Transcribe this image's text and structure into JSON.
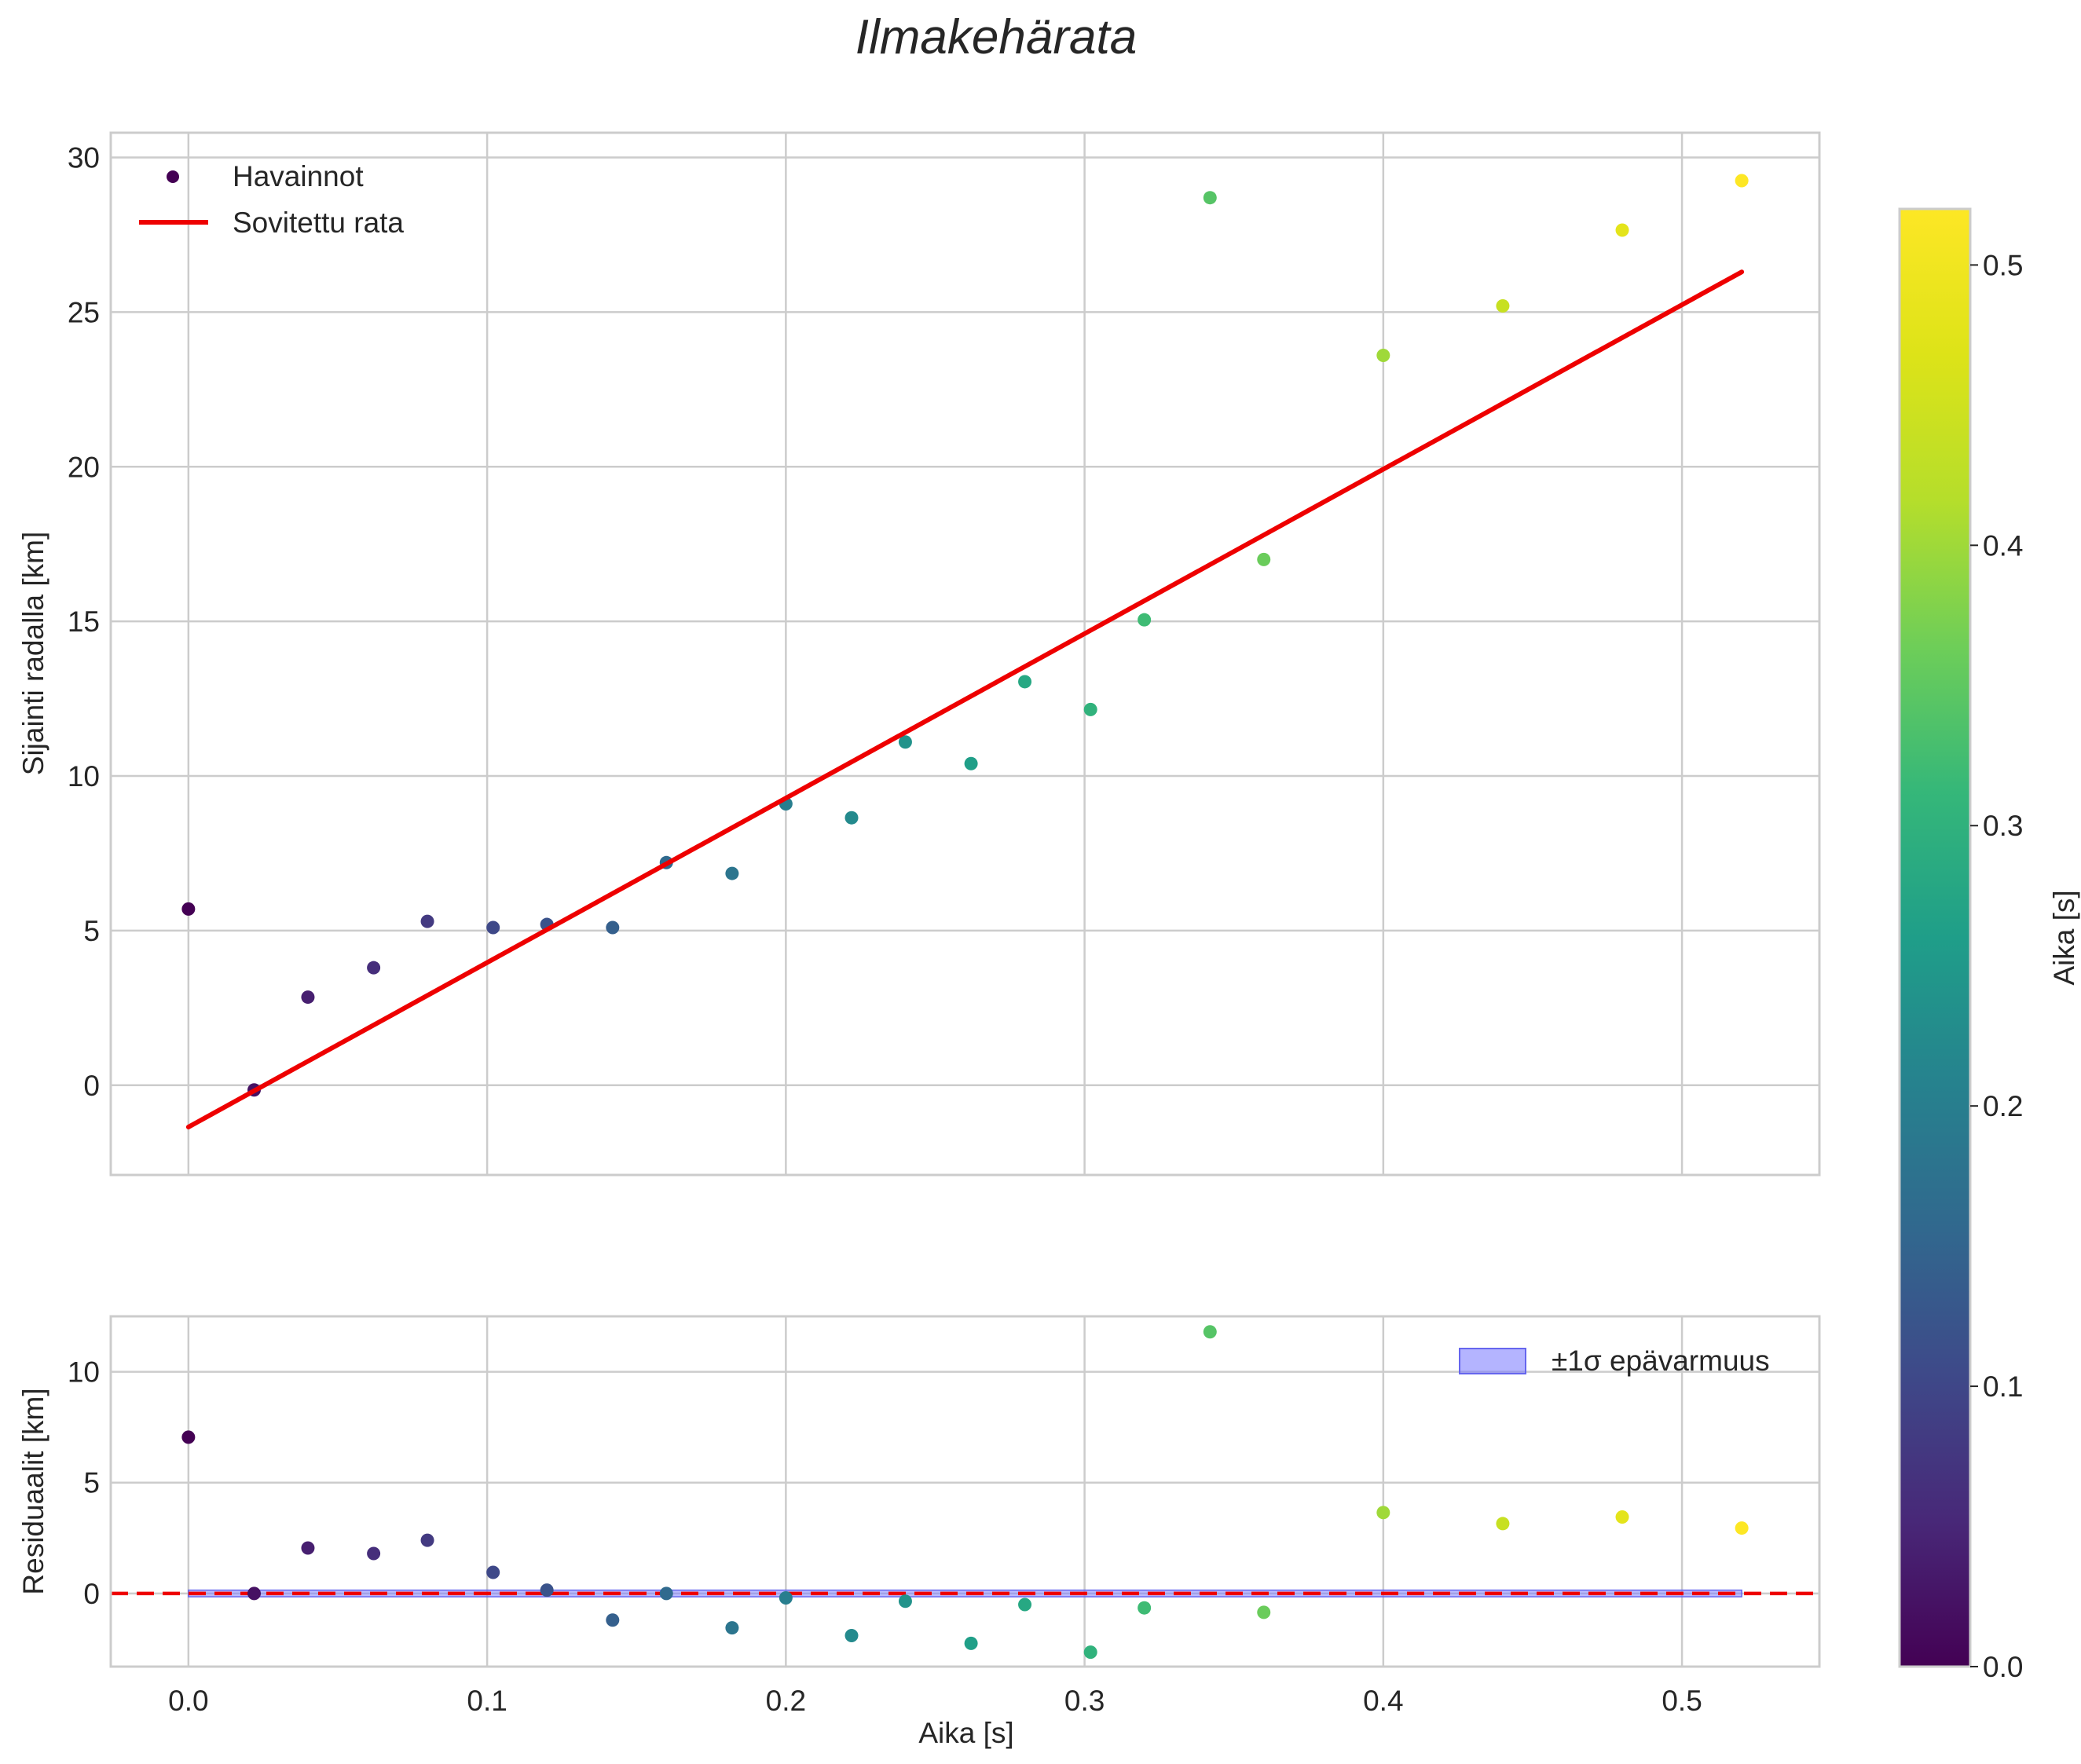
{
  "title": "Ilmakehärata",
  "chart_data": [
    {
      "type": "scatter",
      "panel": "top",
      "ylabel": "Sijainti radalla [km]",
      "xlabel": "",
      "xlim": [
        -0.026,
        0.546
      ],
      "ylim": [
        -2.9,
        30.8
      ],
      "xticks": [
        "0.0",
        "0.1",
        "0.2",
        "0.3",
        "0.4",
        "0.5"
      ],
      "yticks": [
        "0",
        "5",
        "10",
        "15",
        "20",
        "25",
        "30"
      ],
      "grid": true,
      "legend_position": "top-left",
      "series": [
        {
          "name": "Havainnot",
          "type": "scatter",
          "color_by": "Aika [s]",
          "x": [
            0.0,
            0.022,
            0.04,
            0.062,
            0.08,
            0.102,
            0.12,
            0.142,
            0.16,
            0.182,
            0.2,
            0.222,
            0.24,
            0.262,
            0.28,
            0.302,
            0.32,
            0.342,
            0.36,
            0.4,
            0.44,
            0.48,
            0.52
          ],
          "y": [
            5.7,
            -0.15,
            2.85,
            3.8,
            5.3,
            5.1,
            5.2,
            5.1,
            7.2,
            6.85,
            9.1,
            8.65,
            11.1,
            10.4,
            13.05,
            12.15,
            15.05,
            28.7,
            17.0,
            23.6,
            25.2,
            27.65,
            29.25
          ]
        },
        {
          "name": "Sovitettu rata",
          "type": "line",
          "color": "#ee0000",
          "x": [
            0.0,
            0.52
          ],
          "y": [
            -1.35,
            26.3
          ]
        }
      ]
    },
    {
      "type": "scatter",
      "panel": "bottom",
      "ylabel": "Residuaalit [km]",
      "xlabel": "Aika [s]",
      "xlim": [
        -0.026,
        0.546
      ],
      "ylim": [
        -3.3,
        12.5
      ],
      "xticks": [
        "0.0",
        "0.1",
        "0.2",
        "0.3",
        "0.4",
        "0.5"
      ],
      "yticks": [
        "0",
        "5",
        "10"
      ],
      "grid": true,
      "legend_position": "top-right",
      "band": {
        "label": "±1σ epävarmuus",
        "lower": -0.15,
        "upper": 0.15,
        "x": [
          0.0,
          0.52
        ],
        "color": "#7777ff"
      },
      "zero_line": {
        "y": 0,
        "color": "#ee0000",
        "style": "dashed"
      },
      "series": [
        {
          "name": "",
          "type": "scatter",
          "color_by": "Aika [s]",
          "x": [
            0.0,
            0.022,
            0.04,
            0.062,
            0.08,
            0.102,
            0.12,
            0.142,
            0.16,
            0.182,
            0.2,
            0.222,
            0.24,
            0.262,
            0.28,
            0.302,
            0.32,
            0.342,
            0.36,
            0.4,
            0.44,
            0.48,
            0.52
          ],
          "y": [
            7.05,
            0.0,
            2.05,
            1.8,
            2.4,
            0.95,
            0.15,
            -1.2,
            0.0,
            -1.55,
            -0.2,
            -1.9,
            -0.35,
            -2.25,
            -0.5,
            -2.65,
            -0.65,
            11.8,
            -0.85,
            3.65,
            3.15,
            3.45,
            2.95
          ]
        }
      ]
    }
  ],
  "colorbar": {
    "label": "Aika [s]",
    "range": [
      0.0,
      0.52
    ],
    "ticks": [
      "0.0",
      "0.1",
      "0.2",
      "0.3",
      "0.4",
      "0.5"
    ],
    "colormap": "viridis"
  },
  "colors": {
    "fit": "#ee0000",
    "grid": "#cccccc",
    "band": "#7777ff"
  }
}
